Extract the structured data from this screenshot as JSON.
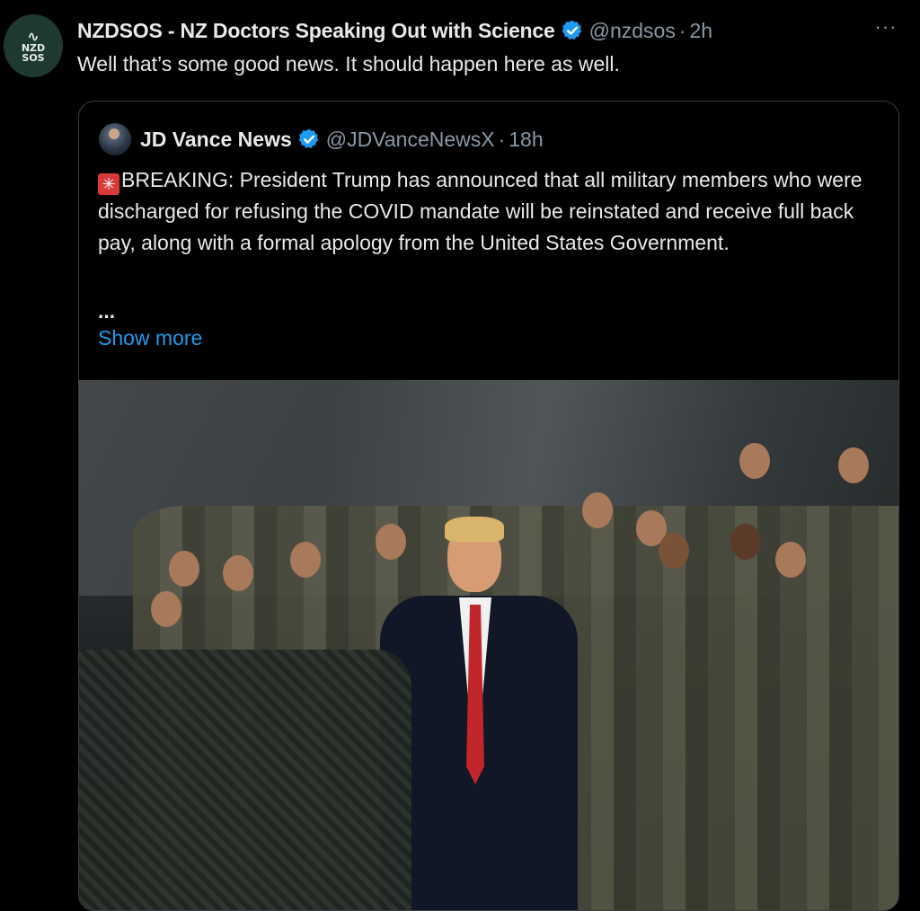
{
  "post": {
    "avatar_lines": [
      "NZD",
      "SOS"
    ],
    "author_name": "NZDSOS - NZ Doctors Speaking Out with Science",
    "handle": "@nzdsos",
    "separator": "·",
    "time": "2h",
    "more_label": "···",
    "text": "Well that’s some good news. It should happen here as well."
  },
  "quoted": {
    "author_name": "JD Vance News",
    "handle": "@JDVanceNewsX",
    "separator": "·",
    "time": "18h",
    "siren_glyph": "✳",
    "body": "BREAKING: President Trump has announced that all military members who were discharged for refusing the COVID mandate will be reinstated and receive full back pay, along with a formal apology from the United States Government.",
    "ellipsis": "...",
    "show_more": "Show more"
  },
  "colors": {
    "background": "#000000",
    "text_primary": "#e7e9ea",
    "text_secondary": "#8b98a5",
    "link": "#1d9bf0",
    "verified": "#1d9bf0",
    "border": "#3a3d40"
  },
  "icons": {
    "verified": "verified-badge-icon",
    "more": "more-horizontal-icon",
    "siren": "siren-emoji-icon"
  }
}
